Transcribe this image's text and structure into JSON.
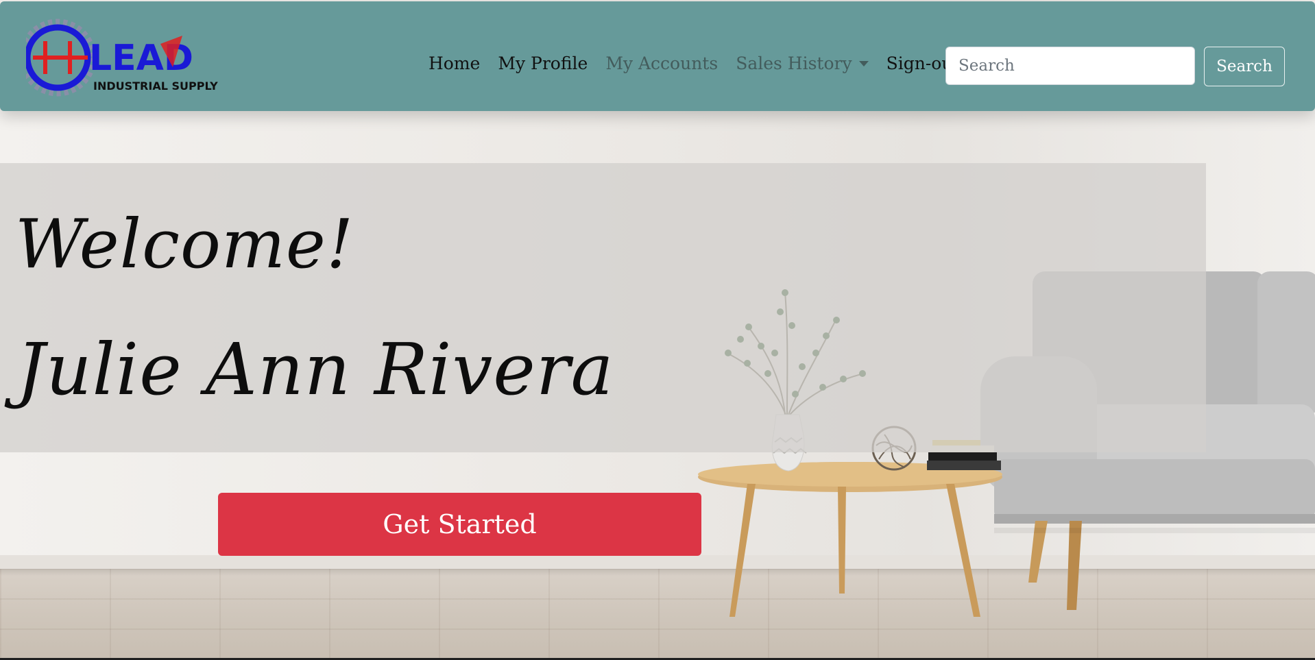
{
  "brand": {
    "logo_letters": "LEAD",
    "logo_subtitle": "INDUSTRIAL SUPPLY"
  },
  "nav": {
    "items": [
      {
        "label": "Home",
        "muted": false
      },
      {
        "label": "My Profile",
        "muted": false
      },
      {
        "label": "My Accounts",
        "muted": true
      },
      {
        "label": "Sales History",
        "muted": true,
        "dropdown": true
      },
      {
        "label": "Sign-out",
        "muted": false
      }
    ],
    "search_placeholder": "Search",
    "search_button": "Search"
  },
  "hero": {
    "welcome": "Welcome!",
    "user_name": "Julie Ann Rivera",
    "cta_label": "Get Started"
  },
  "colors": {
    "navbar_bg": "#669a9a",
    "cta_bg": "#dc3545",
    "logo_blue": "#1a1ad6",
    "logo_red": "#e02020"
  }
}
